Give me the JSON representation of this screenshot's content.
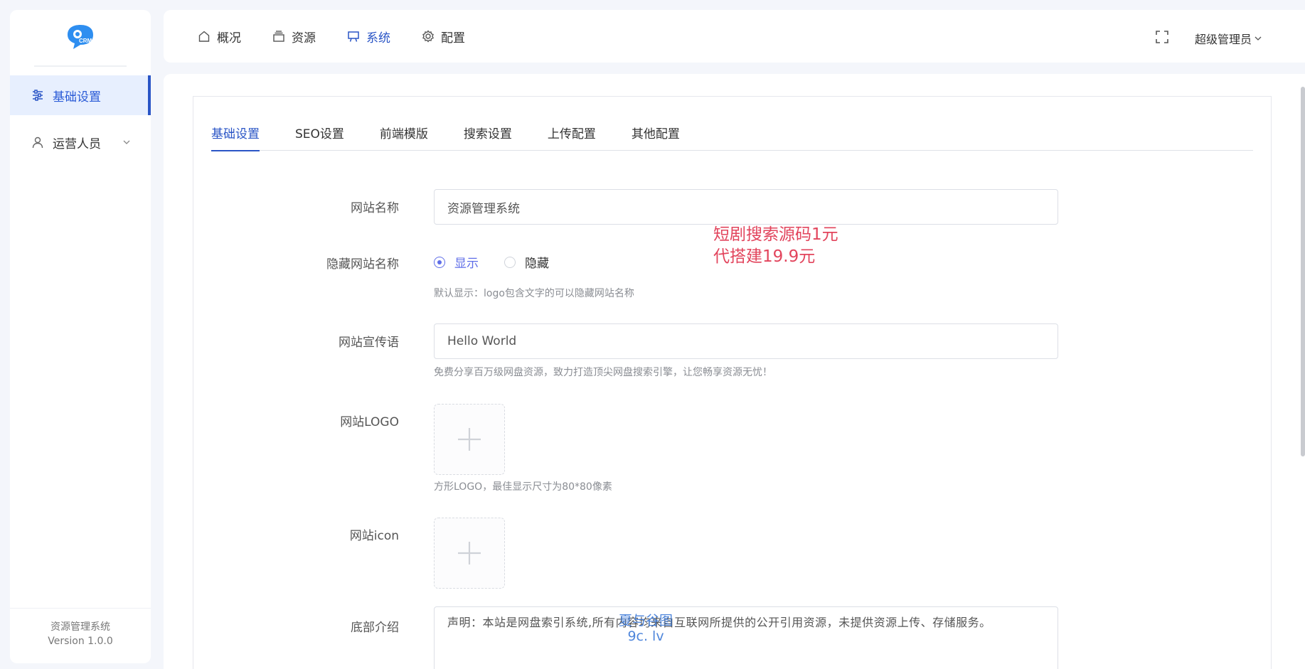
{
  "sidebar": {
    "logo_text": "CRM",
    "items": [
      {
        "label": "基础设置",
        "icon": "sliders-icon",
        "active": true
      },
      {
        "label": "运营人员",
        "icon": "user-icon",
        "active": false
      }
    ],
    "footer": {
      "app_name": "资源管理系统",
      "version": "Version 1.0.0"
    }
  },
  "topbar": {
    "nav": [
      {
        "label": "概况",
        "icon": "home-icon"
      },
      {
        "label": "资源",
        "icon": "stack-icon"
      },
      {
        "label": "系统",
        "icon": "monitor-icon",
        "active": true
      },
      {
        "label": "配置",
        "icon": "gear-icon"
      }
    ],
    "user": "超级管理员"
  },
  "tabs": [
    {
      "label": "基础设置",
      "active": true
    },
    {
      "label": "SEO设置"
    },
    {
      "label": "前端模版"
    },
    {
      "label": "搜索设置"
    },
    {
      "label": "上传配置"
    },
    {
      "label": "其他配置"
    }
  ],
  "form": {
    "site_name": {
      "label": "网站名称",
      "value": "资源管理系统"
    },
    "hide_site_name": {
      "label": "隐藏网站名称",
      "options": [
        {
          "label": "显示",
          "checked": true
        },
        {
          "label": "隐藏",
          "checked": false
        }
      ],
      "hint": "默认显示：logo包含文字的可以隐藏网站名称"
    },
    "slogan": {
      "label": "网站宣传语",
      "value": "Hello World",
      "hint": "免费分享百万级网盘资源，致力打造顶尖网盘搜索引擎，让您畅享资源无忧！"
    },
    "logo": {
      "label": "网站LOGO",
      "hint": "方形LOGO，最佳显示尺寸为80*80像素"
    },
    "icon": {
      "label": "网站icon"
    },
    "footer_intro": {
      "label": "底部介绍",
      "value": "声明：本站是网盘索引系统,所有内容均来自互联网所提供的公开引用资源，未提供资源上传、存储服务。"
    }
  },
  "promo": {
    "line1": "短剧搜索源码1元",
    "line2": "代搭建19.9元"
  },
  "watermark": {
    "line1": "夏与谷图",
    "line2": "9c. lv"
  },
  "colors": {
    "accent": "#2a55c6",
    "radio": "#5f6ee8",
    "promo": "#e2445c"
  }
}
